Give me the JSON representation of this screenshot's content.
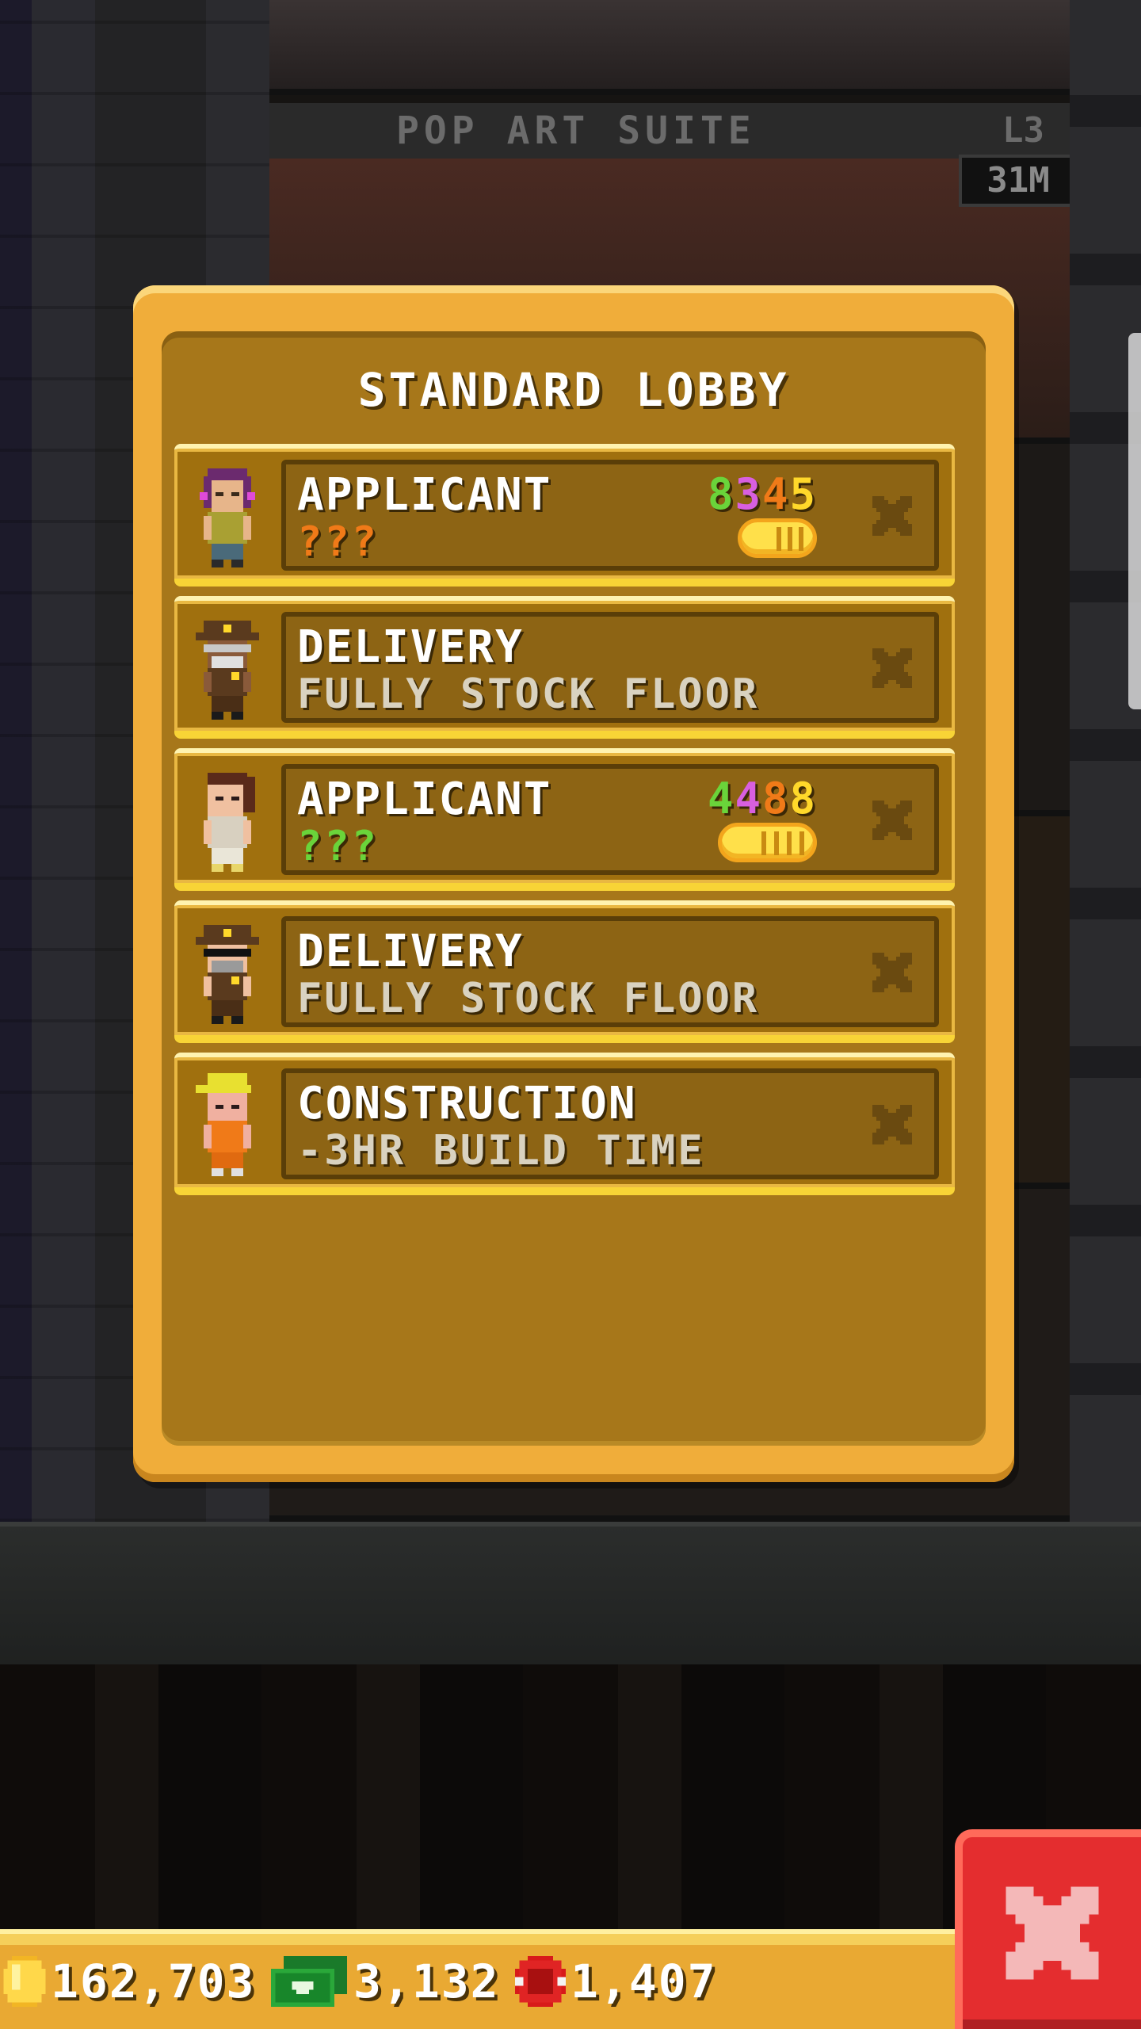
{
  "background": {
    "floor_name": "POP ART SUITE",
    "floor_level": "L3",
    "floor_badge": "31M"
  },
  "dialog": {
    "title": "STANDARD LOBBY",
    "rows": [
      {
        "avatar": "applicant-woman-purple-hair-avatar",
        "title": "APPLICANT",
        "subtitle": "???",
        "subtitle_color": "orange",
        "stats": [
          "8",
          "3",
          "4",
          "5"
        ],
        "stat_colors": [
          "#6ad43a",
          "#d85fe0",
          "#f07a18",
          "#ffd82a"
        ],
        "hire_cost_icon": "coin-pill-icon"
      },
      {
        "avatar": "delivery-man-glasses-avatar",
        "title": "DELIVERY",
        "subtitle": "FULLY STOCK FLOOR"
      },
      {
        "avatar": "applicant-woman-brown-hair-avatar",
        "title": "APPLICANT",
        "subtitle": "???",
        "subtitle_color": "green",
        "stats": [
          "4",
          "4",
          "8",
          "8"
        ],
        "stat_colors": [
          "#6ad43a",
          "#d85fe0",
          "#f07a18",
          "#ffd82a"
        ],
        "hire_cost_icon": "coin-pill-icon"
      },
      {
        "avatar": "delivery-man-sunglasses-avatar",
        "title": "DELIVERY",
        "subtitle": "FULLY STOCK FLOOR"
      },
      {
        "avatar": "construction-worker-avatar",
        "title": "CONSTRUCTION",
        "subtitle": "-3HR BUILD TIME"
      }
    ]
  },
  "currency": {
    "coins": "162,703",
    "bux": "3,132",
    "tickets": "1,407"
  },
  "colors": {
    "dialog_gold": "#f0ad3a",
    "panel_brown": "#8d6414",
    "close_red": "#e42d2f"
  }
}
